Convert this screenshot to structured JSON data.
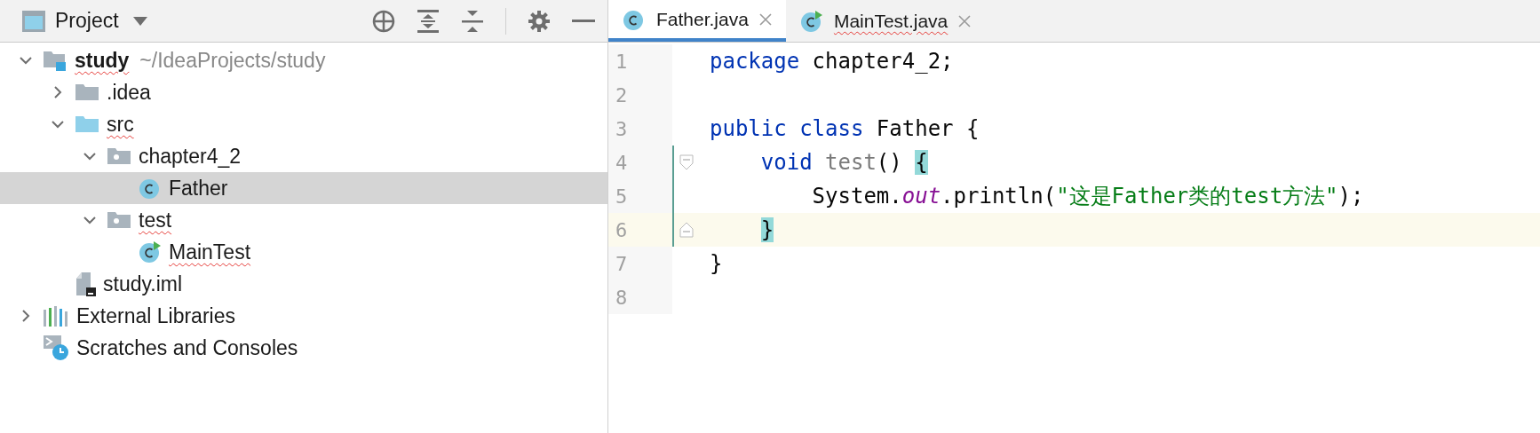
{
  "project_panel": {
    "title": "Project",
    "tree": [
      {
        "kind": "module",
        "label": "study",
        "path": "~/IdeaProjects/study",
        "typo": true,
        "expanded": true,
        "selected": false,
        "children": [
          {
            "kind": "folder",
            "label": ".idea",
            "typo": false,
            "expanded": false,
            "selected": false
          },
          {
            "kind": "source_folder",
            "label": "src",
            "typo": true,
            "expanded": true,
            "selected": false,
            "children": [
              {
                "kind": "package",
                "label": "chapter4_2",
                "typo": false,
                "expanded": true,
                "selected": false,
                "children": [
                  {
                    "kind": "class",
                    "label": "Father",
                    "typo": false,
                    "selected": true
                  }
                ]
              },
              {
                "kind": "package",
                "label": "test",
                "typo": true,
                "expanded": true,
                "selected": false,
                "children": [
                  {
                    "kind": "runnable_class",
                    "label": "MainTest",
                    "typo": true,
                    "selected": false
                  }
                ]
              }
            ]
          },
          {
            "kind": "iml",
            "label": "study.iml",
            "typo": false,
            "selected": false
          }
        ]
      },
      {
        "kind": "libraries",
        "label": "External Libraries",
        "typo": false,
        "expanded": false,
        "selected": false
      },
      {
        "kind": "scratches",
        "label": "Scratches and Consoles",
        "typo": false,
        "selected": false
      }
    ]
  },
  "editor": {
    "tabs": [
      {
        "kind": "class",
        "label": "Father.java",
        "typo": false,
        "selected": true
      },
      {
        "kind": "runnable_class",
        "label": "MainTest.java",
        "typo": true,
        "selected": false
      }
    ],
    "lines": [
      {
        "number": "1",
        "current": false,
        "changed": false,
        "fold_start": false,
        "fold_end": false,
        "tokens": [
          {
            "kind": "keyword",
            "text": "package"
          },
          {
            "kind": "plain",
            "text": " chapter4_2;"
          }
        ]
      },
      {
        "number": "2",
        "current": false,
        "changed": false,
        "fold_start": false,
        "fold_end": false
      },
      {
        "number": "3",
        "current": false,
        "changed": false,
        "fold_start": false,
        "fold_end": false,
        "tokens": [
          {
            "kind": "keyword",
            "text": "public class"
          },
          {
            "kind": "plain",
            "text": " Father {"
          }
        ]
      },
      {
        "number": "4",
        "current": false,
        "changed": true,
        "fold_start": true,
        "fold_end": false,
        "tokens": [
          {
            "kind": "keyword",
            "text": "    void "
          },
          {
            "kind": "unused",
            "text": "test"
          },
          {
            "kind": "plain",
            "text": "() "
          },
          {
            "kind": "brace_match",
            "text": "{"
          }
        ]
      },
      {
        "number": "5",
        "current": false,
        "changed": true,
        "fold_start": false,
        "fold_end": false,
        "tokens": [
          {
            "kind": "plain",
            "text": "        System."
          },
          {
            "kind": "static_field",
            "text": "out"
          },
          {
            "kind": "plain",
            "text": ".println("
          },
          {
            "kind": "string",
            "text": "\"这是Father类的test方法\""
          },
          {
            "kind": "plain",
            "text": ");"
          }
        ]
      },
      {
        "number": "6",
        "current": true,
        "changed": true,
        "fold_start": false,
        "fold_end": true,
        "tokens": [
          {
            "kind": "brace_match",
            "text": "    }"
          }
        ]
      },
      {
        "number": "7",
        "current": false,
        "changed": false,
        "fold_start": false,
        "fold_end": false,
        "tokens": [
          {
            "kind": "plain",
            "text": "}"
          }
        ]
      },
      {
        "number": "8",
        "current": false,
        "changed": false,
        "fold_start": false,
        "fold_end": false
      }
    ]
  }
}
